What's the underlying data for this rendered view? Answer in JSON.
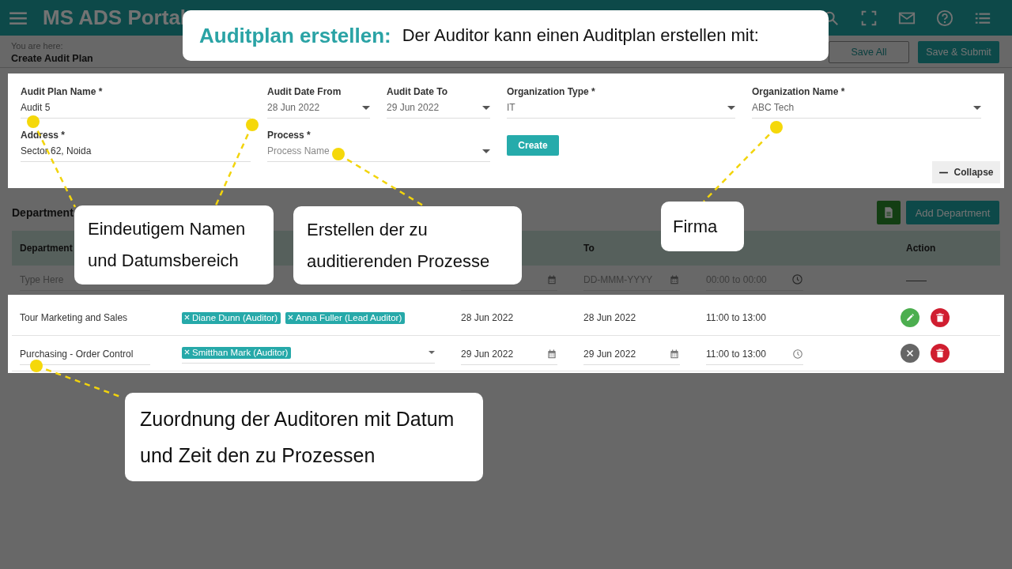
{
  "app": {
    "title": "MS ADS Portal"
  },
  "breadcrumb": {
    "label": "You are here:",
    "current": "Create Audit Plan"
  },
  "header_buttons": [
    {
      "label": "Save All",
      "kind": "outline"
    },
    {
      "label": "Save & Submit",
      "kind": "primary"
    }
  ],
  "form": {
    "fields": [
      {
        "label": "Audit Plan Name *",
        "value": "Audit 5",
        "kind": "text"
      },
      {
        "label": "Audit Date From",
        "value": "28 Jun 2022",
        "kind": "select"
      },
      {
        "label": "Audit Date To",
        "value": "29 Jun 2022",
        "kind": "select"
      },
      {
        "label": "Organization Type *",
        "value": "IT",
        "kind": "select"
      },
      {
        "label": "Organization Name *",
        "value": "ABC Tech",
        "kind": "select"
      },
      {
        "label": "Address *",
        "value": "Sector 62, Noida",
        "kind": "text"
      },
      {
        "label": "Process *",
        "placeholder": "Process Name",
        "kind": "select"
      }
    ],
    "create_button": "Create",
    "collapse_button": "Collapse"
  },
  "departments": {
    "title": "Department",
    "add_button": "Add Department",
    "columns": [
      {
        "label": "Department"
      },
      {
        "label": "To"
      },
      {
        "label": "Action"
      }
    ],
    "filter": {
      "department_placeholder": "Type Here",
      "to_placeholder": "DD-MMM-YYYY",
      "time_placeholder": "00:00 to 00:00",
      "action": "——"
    },
    "rows": [
      {
        "department": "Tour Marketing and Sales",
        "auditors": [
          "Diane Dunn (Auditor)",
          "Anna Fuller (Lead Auditor)"
        ],
        "from": "28 Jun 2022",
        "to": "28 Jun 2022",
        "time": "11:00 to 13:00",
        "editing": false
      },
      {
        "department": "Purchasing - Order Control",
        "auditors": [
          "Smitthan Mark (Auditor)"
        ],
        "from": "29 Jun 2022",
        "to": "29 Jun 2022",
        "time": "11:00 to 13:00",
        "editing": true
      }
    ]
  },
  "callouts": [
    {
      "kind": "title",
      "heading": "Auditplan erstellen:",
      "text": "Der Auditor kann einen Auditplan erstellen mit:"
    },
    {
      "kind": "note",
      "text": "Eindeutigem Namen und Datumsbereich"
    },
    {
      "kind": "note",
      "text": "Erstellen der zu auditierenden Prozesse"
    },
    {
      "kind": "note",
      "text": "Firma"
    },
    {
      "kind": "note",
      "text": "Zuordnung der Auditoren mit Datum und Zeit den zu Prozessen"
    }
  ]
}
